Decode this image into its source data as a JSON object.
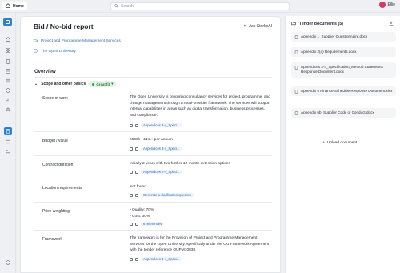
{
  "topbar": {
    "home_label": "Home",
    "search_placeholder": "Search",
    "user_name": "Ellie"
  },
  "page": {
    "title": "Bid / No-bid report",
    "ask_label": "Ask StorkeAI",
    "project_link": "Project and Programme Management Services",
    "org_link": "The Open University",
    "overview_label": "Overview",
    "section_label": "Scope and other basics",
    "fit_badge": "Great fit"
  },
  "rows": {
    "scope": {
      "label": "Scope of work",
      "value": "The Open University is procuring consultancy services for project, programme, and change management through a multi-provider framework. The services will support internal capabilities in areas such as digital transformation, business processes, and compliance.",
      "ref": "Appendices 3-4_Speci..."
    },
    "budget": {
      "label": "Budget / value",
      "value": "£500k - £1m+ per annum",
      "ref": "Appendices 3-4_Speci..."
    },
    "duration": {
      "label": "Contract duration",
      "value": "Initially 2 years with two further 12-month extension options",
      "ref": "Appendices 3-4_Speci..."
    },
    "location": {
      "label": "Location requirements",
      "value": "Not found",
      "ref": "Generate a clarification question"
    },
    "price": {
      "label": "Price weighting",
      "bullet1": "Quality: 70%",
      "bullet2": "Cost: 30%",
      "ref": "6 references"
    },
    "framework": {
      "label": "Framework",
      "value": "The framework is for the Provision of Project and Programme Management Services for the Open University, specifically under the OU Framework Agreement with the tender reference OUPM10830.",
      "ref": "Appendices 3-4_Speci..."
    }
  },
  "tender": {
    "title": "Tender documents (5)",
    "docs": [
      "Appendix 1_Supplier Questionnaire.docx",
      "Appendix 2(a) Requirements.docx",
      "Appendices 3-4_Specification_Method Statements Response Document.docx",
      "Appendix 5 Finance Schedule Response Document.xlsx",
      "Appendix 6b_Supplier Code of Conduct.docx"
    ],
    "upload_label": "Upload document"
  },
  "colors": {
    "accent": "#2c82c9",
    "link": "#2c6fb9",
    "fit_bg": "#e3f2e6",
    "fit_text": "#2f7a43",
    "avatar": "#d83a66"
  }
}
